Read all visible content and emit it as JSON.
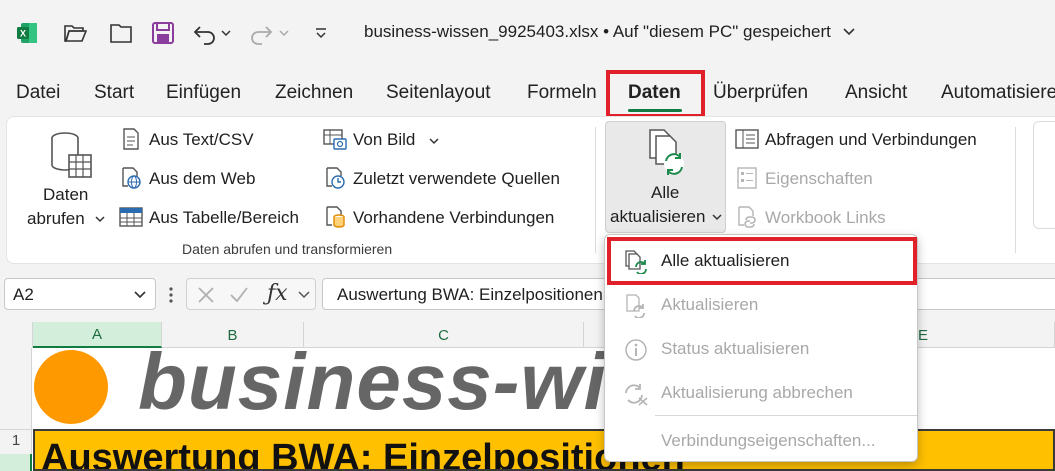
{
  "titlebar": {
    "file_title": "business-wissen_9925403.xlsx • Auf \"diesem PC\" gespeichert",
    "icons": [
      "excel-logo",
      "open-folder",
      "new-file",
      "save",
      "undo",
      "redo",
      "customize-qat"
    ]
  },
  "tabs": [
    "Datei",
    "Start",
    "Einfügen",
    "Zeichnen",
    "Seitenlayout",
    "Formeln",
    "Daten",
    "Überprüfen",
    "Ansicht",
    "Automatisieren"
  ],
  "active_tab": "Daten",
  "ribbon": {
    "get_data": {
      "line1": "Daten",
      "line2": "abrufen"
    },
    "col1": [
      "Aus Text/CSV",
      "Aus dem Web",
      "Aus Tabelle/Bereich"
    ],
    "col2": [
      "Von Bild",
      "Zuletzt verwendete Quellen",
      "Vorhandene Verbindungen"
    ],
    "group_label": "Daten abrufen und transformieren",
    "refresh_all": {
      "line1": "Alle",
      "line2": "aktualisieren"
    },
    "col3": [
      "Abfragen und Verbindungen",
      "Eigenschaften",
      "Workbook Links"
    ]
  },
  "formula_bar": {
    "name_box": "A2",
    "formula": "Auswertung BWA: Einzelpositionen"
  },
  "grid": {
    "columns": [
      "A",
      "B",
      "C",
      "E"
    ],
    "rows": [
      "1"
    ],
    "logo_text": "business-wissen.de",
    "title_cell": "Auswertung BWA: Einzelpositionen"
  },
  "dropdown": {
    "items": [
      {
        "label": "Alle aktualisieren",
        "enabled": true
      },
      {
        "label": "Aktualisieren",
        "enabled": false
      },
      {
        "label": "Status aktualisieren",
        "enabled": false
      },
      {
        "label": "Aktualisierung abbrechen",
        "enabled": false
      },
      {
        "label": "Verbindungseigenschaften...",
        "enabled": false
      }
    ]
  },
  "colors": {
    "excel_green": "#107c41",
    "highlight_red": "#e0212a",
    "logo_orange": "#ff9900",
    "title_fill": "#ffc000"
  }
}
